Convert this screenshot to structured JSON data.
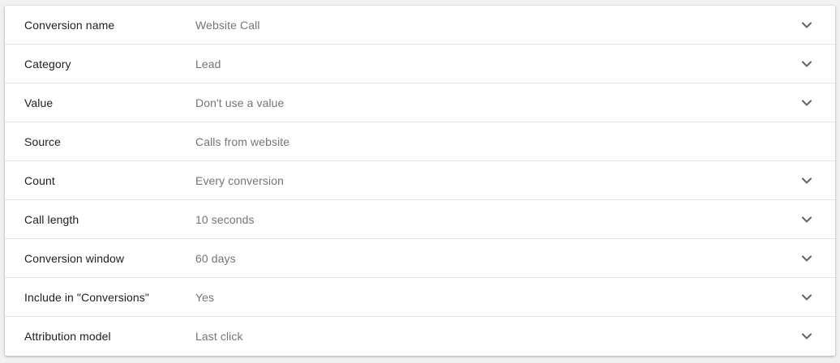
{
  "settings": {
    "rows": [
      {
        "label": "Conversion name",
        "value": "Website Call",
        "expandable": true,
        "icon": "chevron-down-icon"
      },
      {
        "label": "Category",
        "value": "Lead",
        "expandable": true,
        "icon": "chevron-down-icon"
      },
      {
        "label": "Value",
        "value": "Don't use a value",
        "expandable": true,
        "icon": "chevron-down-icon"
      },
      {
        "label": "Source",
        "value": "Calls from website",
        "expandable": false
      },
      {
        "label": "Count",
        "value": "Every conversion",
        "expandable": true,
        "icon": "chevron-down-icon"
      },
      {
        "label": "Call length",
        "value": "10 seconds",
        "expandable": true,
        "icon": "chevron-down-icon"
      },
      {
        "label": "Conversion window",
        "value": "60 days",
        "expandable": true,
        "icon": "chevron-down-icon"
      },
      {
        "label": "Include in \"Conversions\"",
        "value": "Yes",
        "expandable": true,
        "icon": "chevron-down-icon"
      },
      {
        "label": "Attribution model",
        "value": "Last click",
        "expandable": true,
        "icon": "chevron-down-icon"
      }
    ]
  },
  "colors": {
    "label_text": "#212121",
    "value_text": "#757575",
    "divider": "#e3e3e3",
    "chevron": "#5f6368",
    "background": "#f1f1f1",
    "panel": "#ffffff"
  }
}
